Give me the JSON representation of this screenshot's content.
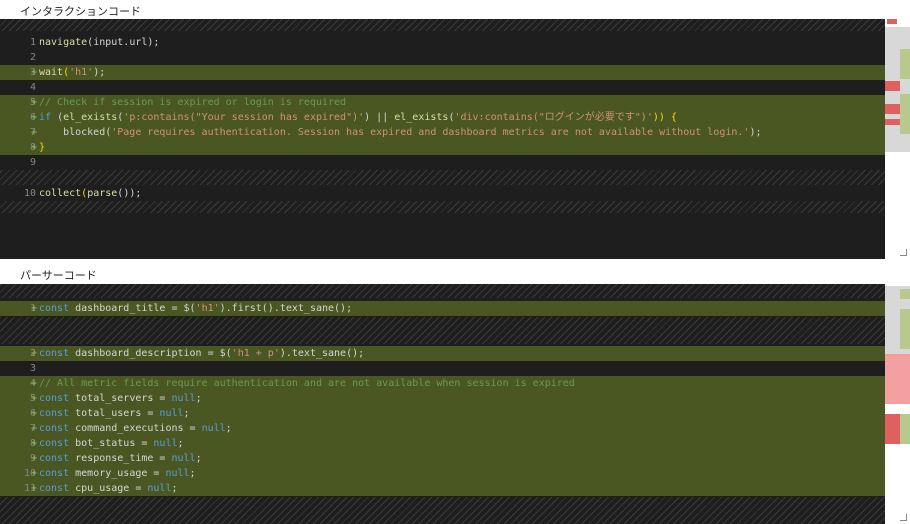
{
  "interaction_section": {
    "title": "インタラクションコード",
    "lines": [
      {
        "num": "1",
        "marker": "",
        "tokens": [
          {
            "t": "navigate",
            "c": "fn"
          },
          {
            "t": "(input.url);",
            "c": ""
          }
        ]
      },
      {
        "num": "2",
        "marker": "",
        "tokens": []
      },
      {
        "num": "3",
        "marker": "+",
        "tokens": [
          {
            "t": "wait",
            "c": "fn"
          },
          {
            "t": "(",
            "c": "br"
          },
          {
            "t": "'h1'",
            "c": "str"
          },
          {
            "t": ");",
            "c": ""
          }
        ]
      },
      {
        "num": "4",
        "marker": "",
        "tokens": []
      },
      {
        "num": "5",
        "marker": "+",
        "tokens": [
          {
            "t": "// Check if session is expired or login is required",
            "c": "cm"
          }
        ]
      },
      {
        "num": "6",
        "marker": "+",
        "tokens": [
          {
            "t": "if",
            "c": "kw"
          },
          {
            "t": " (",
            "c": ""
          },
          {
            "t": "el_exists",
            "c": "fn"
          },
          {
            "t": "(",
            "c": ""
          },
          {
            "t": "'p:contains(\"Your session has expired\")'",
            "c": "str"
          },
          {
            "t": ") || ",
            "c": ""
          },
          {
            "t": "el_exists",
            "c": "fn"
          },
          {
            "t": "(",
            "c": ""
          },
          {
            "t": "'div:contains(\"ログインが必要です\")'",
            "c": "str"
          },
          {
            "t": ")) {",
            "c": "br"
          }
        ]
      },
      {
        "num": "7",
        "marker": "+",
        "tokens": [
          {
            "t": "    blocked(",
            "c": ""
          },
          {
            "t": "'Page requires authentication. Session has expired and dashboard metrics are not available without login.'",
            "c": "str"
          },
          {
            "t": ");",
            "c": ""
          }
        ]
      },
      {
        "num": "8",
        "marker": "+",
        "tokens": [
          {
            "t": "}",
            "c": "br"
          }
        ]
      },
      {
        "num": "9",
        "marker": "",
        "tokens": []
      },
      {
        "num": "10",
        "marker": "",
        "tokens": [
          {
            "t": "collect",
            "c": "fn"
          },
          {
            "t": "(",
            "c": "br"
          },
          {
            "t": "parse",
            "c": "fn"
          },
          {
            "t": "());",
            "c": ""
          }
        ]
      }
    ]
  },
  "parser_section": {
    "title": "パーサーコード",
    "lines": [
      {
        "num": "1",
        "marker": "+",
        "tokens": [
          {
            "t": "const",
            "c": "kw"
          },
          {
            "t": " dashboard_title = $(",
            "c": ""
          },
          {
            "t": "'h1'",
            "c": "str"
          },
          {
            "t": ").first().text_sane();",
            "c": ""
          }
        ]
      },
      {
        "num": "2",
        "marker": "+",
        "tokens": [
          {
            "t": "const",
            "c": "kw"
          },
          {
            "t": " dashboard_description = $(",
            "c": ""
          },
          {
            "t": "'h1 + p'",
            "c": "str"
          },
          {
            "t": ").text_sane();",
            "c": ""
          }
        ]
      },
      {
        "num": "3",
        "marker": "",
        "tokens": []
      },
      {
        "num": "4",
        "marker": "+",
        "tokens": [
          {
            "t": "// All metric fields require authentication and are not available when session is expired",
            "c": "cm"
          }
        ]
      },
      {
        "num": "5",
        "marker": "+",
        "tokens": [
          {
            "t": "const",
            "c": "kw"
          },
          {
            "t": " total_servers = ",
            "c": ""
          },
          {
            "t": "null",
            "c": "kw"
          },
          {
            "t": ";",
            "c": ""
          }
        ]
      },
      {
        "num": "6",
        "marker": "+",
        "tokens": [
          {
            "t": "const",
            "c": "kw"
          },
          {
            "t": " total_users = ",
            "c": ""
          },
          {
            "t": "null",
            "c": "kw"
          },
          {
            "t": ";",
            "c": ""
          }
        ]
      },
      {
        "num": "7",
        "marker": "+",
        "tokens": [
          {
            "t": "const",
            "c": "kw"
          },
          {
            "t": " command_executions = ",
            "c": ""
          },
          {
            "t": "null",
            "c": "kw"
          },
          {
            "t": ";",
            "c": ""
          }
        ]
      },
      {
        "num": "8",
        "marker": "+",
        "tokens": [
          {
            "t": "const",
            "c": "kw"
          },
          {
            "t": " bot_status = ",
            "c": ""
          },
          {
            "t": "null",
            "c": "kw"
          },
          {
            "t": ";",
            "c": ""
          }
        ]
      },
      {
        "num": "9",
        "marker": "+",
        "tokens": [
          {
            "t": "const",
            "c": "kw"
          },
          {
            "t": " response_time = ",
            "c": ""
          },
          {
            "t": "null",
            "c": "kw"
          },
          {
            "t": ";",
            "c": ""
          }
        ]
      },
      {
        "num": "10",
        "marker": "+",
        "tokens": [
          {
            "t": "const",
            "c": "kw"
          },
          {
            "t": " memory_usage = ",
            "c": ""
          },
          {
            "t": "null",
            "c": "kw"
          },
          {
            "t": ";",
            "c": ""
          }
        ]
      },
      {
        "num": "11",
        "marker": "+",
        "tokens": [
          {
            "t": "const",
            "c": "kw"
          },
          {
            "t": " cpu_usage = ",
            "c": ""
          },
          {
            "t": "null",
            "c": "kw"
          },
          {
            "t": ";",
            "c": ""
          }
        ]
      }
    ]
  },
  "colors": {
    "editor_bg": "#1e1e1e",
    "added_line_bg": "#4b5723",
    "minimap_add": "#b9c88c",
    "minimap_remove": "#e06060"
  }
}
